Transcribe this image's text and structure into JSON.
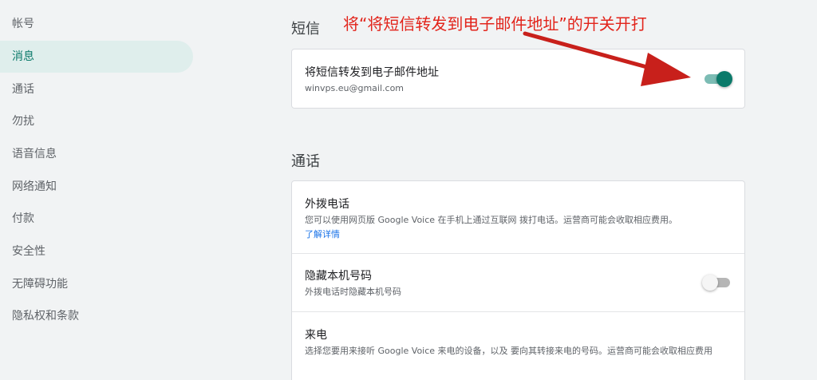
{
  "sidebar": {
    "items": [
      {
        "label": "帐号",
        "active": false
      },
      {
        "label": "消息",
        "active": true
      },
      {
        "label": "通话",
        "active": false
      },
      {
        "label": "勿扰",
        "active": false
      },
      {
        "label": "语音信息",
        "active": false
      },
      {
        "label": "网络通知",
        "active": false
      },
      {
        "label": "付款",
        "active": false
      },
      {
        "label": "安全性",
        "active": false
      },
      {
        "label": "无障碍功能",
        "active": false
      },
      {
        "label": "隐私权和条款",
        "active": false
      }
    ]
  },
  "sms": {
    "title": "短信",
    "forward": {
      "title": "将短信转发到电子邮件地址",
      "email": "winvps.eu@gmail.com",
      "enabled": true
    }
  },
  "calls": {
    "title": "通话",
    "outbound": {
      "title": "外拨电话",
      "description": "您可以使用网页版 Google Voice 在手机上通过互联网 拨打电话。运营商可能会收取相应费用。",
      "link": "了解详情"
    },
    "hide_number": {
      "title": "隐藏本机号码",
      "description": "外拨电话时隐藏本机号码",
      "enabled": false
    },
    "incoming": {
      "title": "来电",
      "description": "选择您要用来接听 Google Voice 来电的设备，以及 要向其转接来电的号码。运营商可能会收取相应费用"
    }
  },
  "annotation": {
    "text": "将“将短信转发到电子邮件地址”的开关开打",
    "color": "#e2241b"
  },
  "colors": {
    "accent": "#0b7a6a",
    "link": "#1a73e8",
    "page_bg": "#f1f3f4"
  }
}
